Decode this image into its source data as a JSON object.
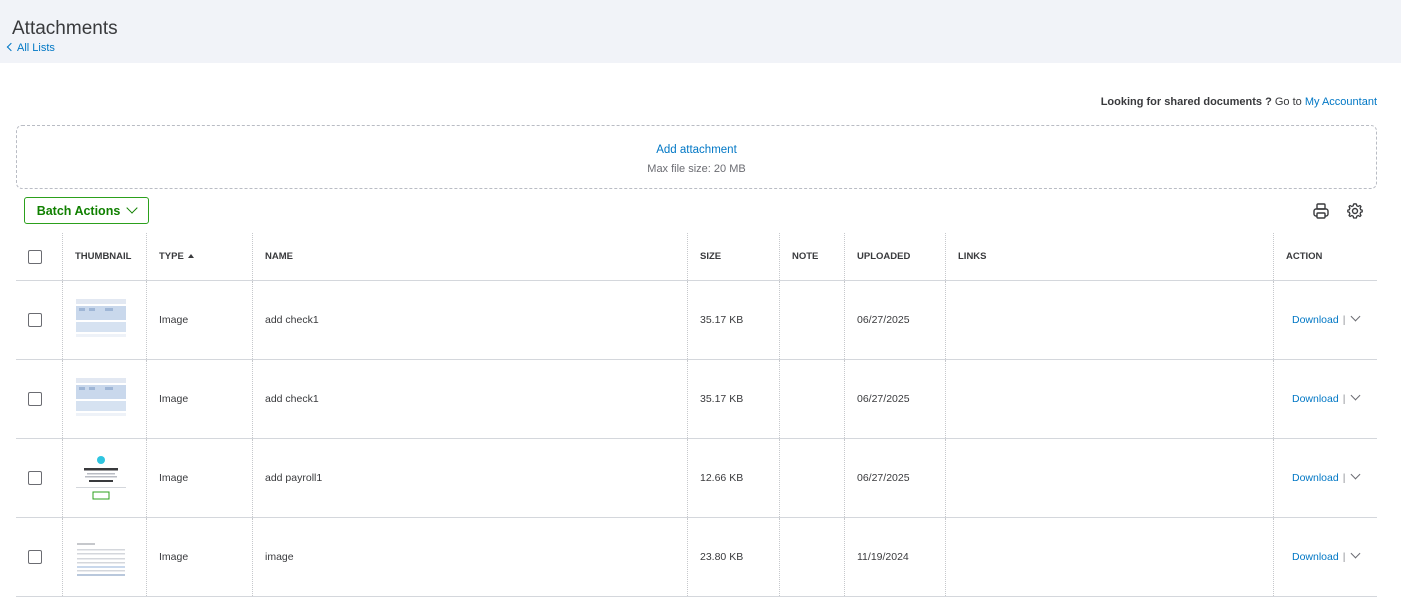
{
  "header": {
    "title": "Attachments",
    "back_label": "All Lists"
  },
  "shared": {
    "prefix": "Looking for shared documents ?",
    "middle": " Go to ",
    "link": "My Accountant"
  },
  "dropzone": {
    "add_label": "Add attachment",
    "max_size": "Max file size: 20 MB"
  },
  "toolbar": {
    "batch_label": "Batch Actions",
    "print_icon": "printer-icon",
    "settings_icon": "gear-icon"
  },
  "table": {
    "columns": {
      "thumbnail": "THUMBNAIL",
      "type": "TYPE",
      "name": "NAME",
      "size": "SIZE",
      "note": "NOTE",
      "uploaded": "UPLOADED",
      "links": "LINKS",
      "action": "ACTION"
    },
    "rows": [
      {
        "type": "Image",
        "name": "add check1",
        "size": "35.17 KB",
        "note": "",
        "uploaded": "06/27/2025",
        "links": "",
        "action": "Download",
        "thumb": "check-screenshot"
      },
      {
        "type": "Image",
        "name": "add check1",
        "size": "35.17 KB",
        "note": "",
        "uploaded": "06/27/2025",
        "links": "",
        "action": "Download",
        "thumb": "check-screenshot"
      },
      {
        "type": "Image",
        "name": "add payroll1",
        "size": "12.66 KB",
        "note": "",
        "uploaded": "06/27/2025",
        "links": "",
        "action": "Download",
        "thumb": "payroll-screenshot"
      },
      {
        "type": "Image",
        "name": "image",
        "size": "23.80 KB",
        "note": "",
        "uploaded": "11/19/2024",
        "links": "",
        "action": "Download",
        "thumb": "document-screenshot"
      }
    ]
  },
  "colors": {
    "link": "#0077c5",
    "green": "#2ca01c",
    "header_bg": "#f1f3f8"
  }
}
